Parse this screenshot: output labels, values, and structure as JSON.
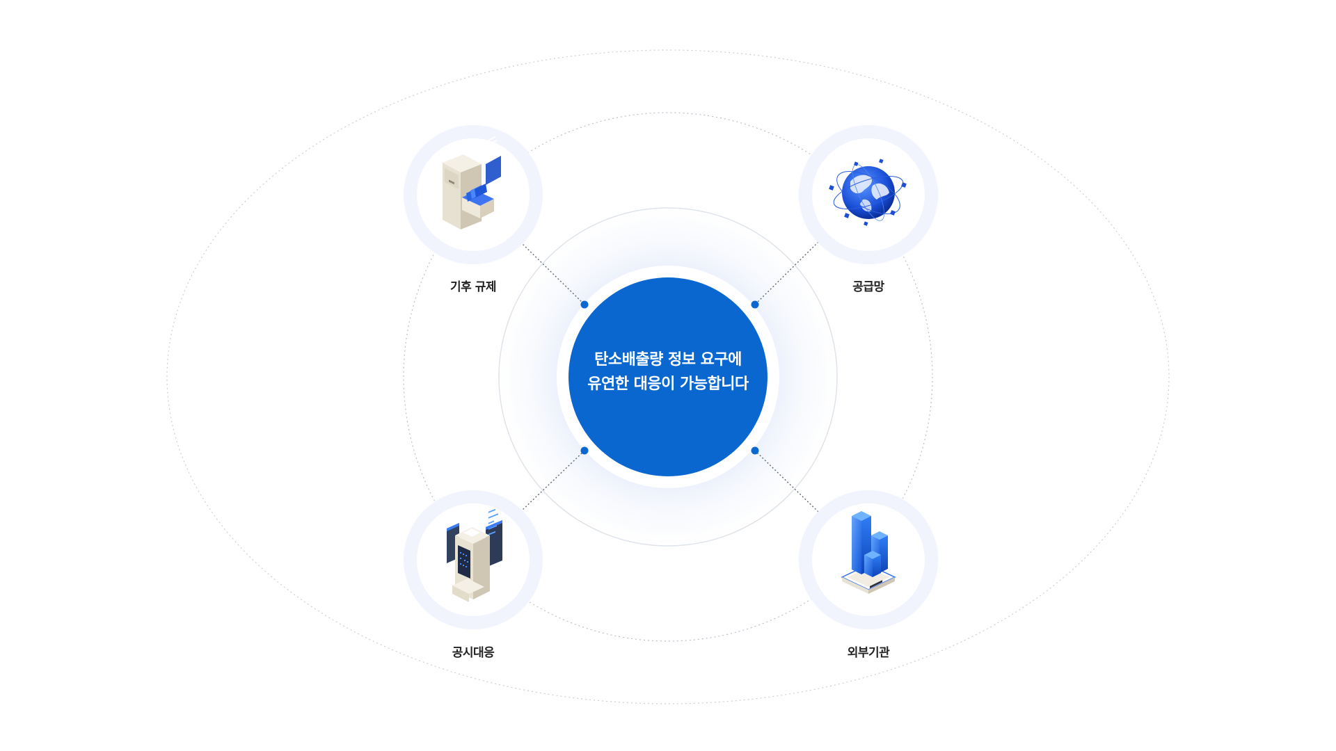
{
  "center": {
    "line1": "탄소배출량 정보 요구에",
    "line2": "유연한 대응이 가능합니다",
    "color": "#0a67d0"
  },
  "nodes": [
    {
      "id": "climate-regulation",
      "label": "기후 규제",
      "icon": "file-cabinet-icon"
    },
    {
      "id": "supply-chain",
      "label": "공급망",
      "icon": "globe-network-icon"
    },
    {
      "id": "disclosure",
      "label": "공시대응",
      "icon": "server-data-icon"
    },
    {
      "id": "external-agency",
      "label": "외부기관",
      "icon": "building-icon"
    }
  ],
  "colors": {
    "accent": "#0a67d0",
    "dotted_line": "#9aa3b2",
    "ring": "#dfe3ea"
  }
}
